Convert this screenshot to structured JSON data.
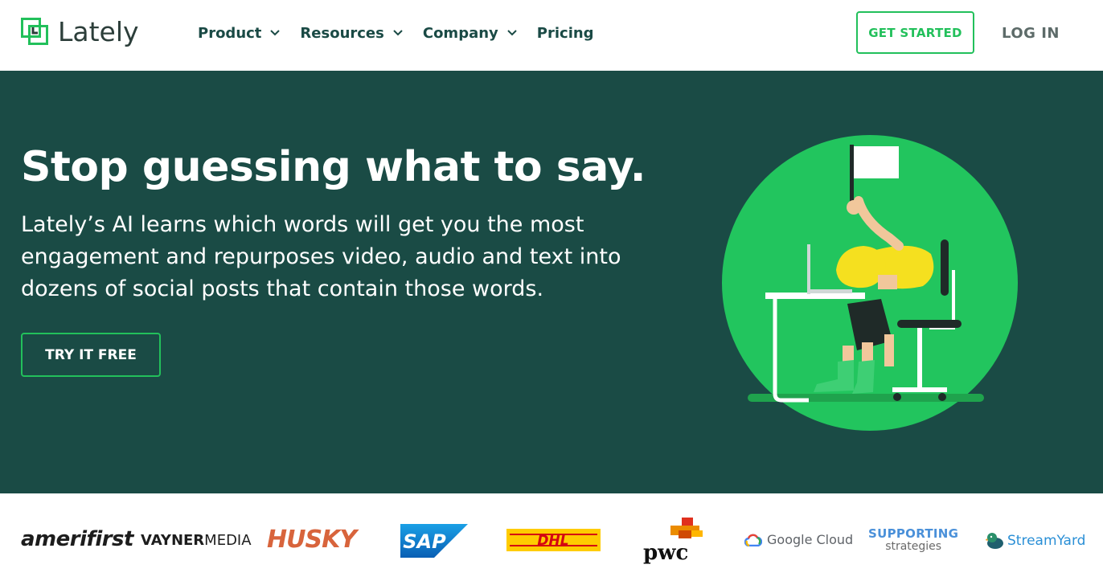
{
  "header": {
    "logo_text": "Lately",
    "nav": [
      {
        "label": "Product",
        "has_dropdown": true
      },
      {
        "label": "Resources",
        "has_dropdown": true
      },
      {
        "label": "Company",
        "has_dropdown": true
      },
      {
        "label": "Pricing",
        "has_dropdown": false
      }
    ],
    "get_started_label": "GET STARTED",
    "login_label": "LOG IN"
  },
  "hero": {
    "title": "Stop guessing what to say.",
    "subtitle": "Lately’s AI learns which words will get you the most engagement and repurposes video, audio and text into dozens of social posts that contain those words.",
    "cta_label": "TRY IT FREE"
  },
  "logos": {
    "amerifirst": "amerifirst",
    "vayner_bold": "VAYNER",
    "vayner_light": "MEDIA",
    "husky": "HUSKY",
    "sap": "SAP",
    "dhl": "DHL",
    "pwc": "pwc",
    "google_cloud": "Google Cloud",
    "supporting_line1": "SUPPORTING",
    "supporting_line2": "strategies",
    "streamyard": "StreamYard"
  },
  "colors": {
    "brand_green": "#22c05b",
    "hero_bg": "#1a4b45",
    "nav_text": "#1a4a45",
    "illustration_circle": "#22c55e"
  }
}
